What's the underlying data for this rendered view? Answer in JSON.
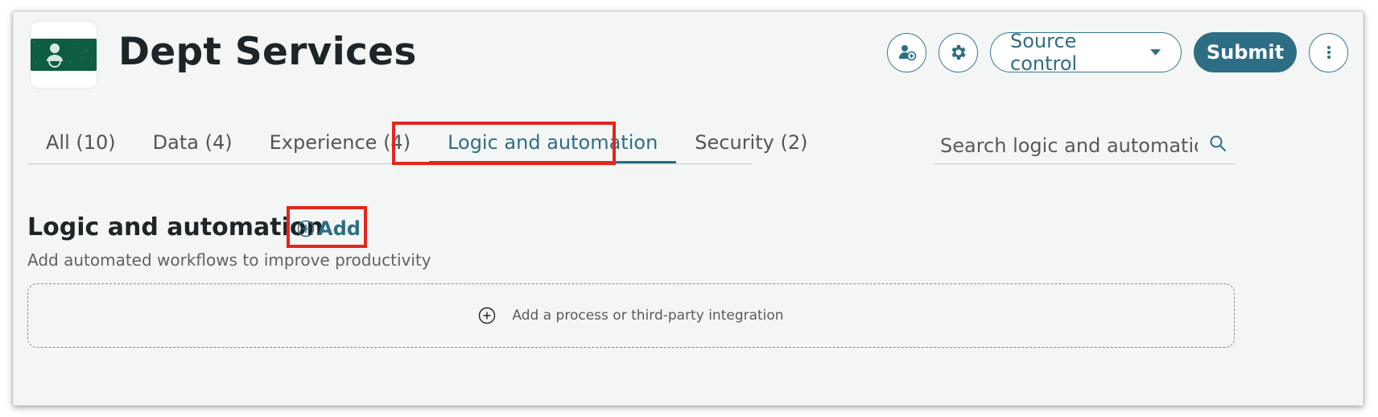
{
  "header": {
    "title": "Dept Services",
    "source_control_label": "Source control",
    "submit_label": "Submit"
  },
  "tabs": [
    {
      "label": "All (10)"
    },
    {
      "label": "Data (4)"
    },
    {
      "label": "Experience (4)"
    },
    {
      "label": "Logic and automation",
      "active": true
    },
    {
      "label": "Security (2)"
    }
  ],
  "search": {
    "placeholder": "Search logic and automation"
  },
  "section": {
    "title": "Logic and automation",
    "add_label": "Add",
    "subtitle": "Add automated workflows to improve productivity",
    "dropzone_label": "Add a process or third-party integration"
  },
  "colors": {
    "accent": "#2d6e85",
    "highlight": "#e3261e",
    "app_tile": "#0e5c44"
  },
  "icons": [
    "app-logo-icon",
    "add-user-icon",
    "gear-icon",
    "caret-down-icon",
    "more-vertical-icon",
    "search-icon",
    "plus-circle-icon"
  ]
}
